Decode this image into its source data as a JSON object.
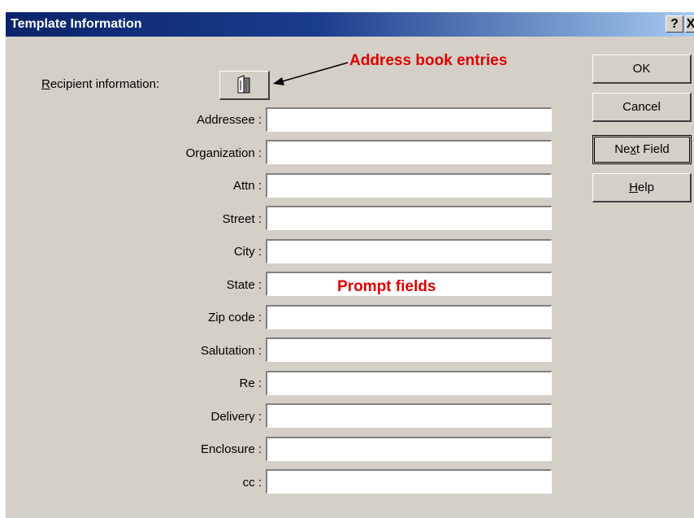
{
  "window": {
    "title": "Template Information",
    "help_button": "?",
    "close_button": "X"
  },
  "recipient": {
    "label_underline": "R",
    "label_rest": "ecipient information:"
  },
  "fields": [
    {
      "label": "Addressee :",
      "value": ""
    },
    {
      "label": "Organization :",
      "value": ""
    },
    {
      "label": "Attn :",
      "value": ""
    },
    {
      "label": "Street :",
      "value": ""
    },
    {
      "label": "City :",
      "value": ""
    },
    {
      "label": "State :",
      "value": ""
    },
    {
      "label": "Zip code :",
      "value": ""
    },
    {
      "label": "Salutation :",
      "value": ""
    },
    {
      "label": "Re :",
      "value": ""
    },
    {
      "label": "Delivery :",
      "value": ""
    },
    {
      "label": "Enclosure :",
      "value": ""
    },
    {
      "label": "cc :",
      "value": ""
    }
  ],
  "buttons": {
    "ok": "OK",
    "cancel": "Cancel",
    "next_field_pre": "Ne",
    "next_field_ul": "x",
    "next_field_post": "t Field",
    "help_ul": "H",
    "help_rest": "elp"
  },
  "annotations": {
    "address_book": "Address book entries",
    "prompt_fields": "Prompt fields"
  },
  "colors": {
    "annotation": "#e00000",
    "title_bar": "#0a246a",
    "dialog_face": "#d4d0c8"
  },
  "icons": {
    "address_book_button": "address-book-icon",
    "arrow": "arrow-icon"
  }
}
